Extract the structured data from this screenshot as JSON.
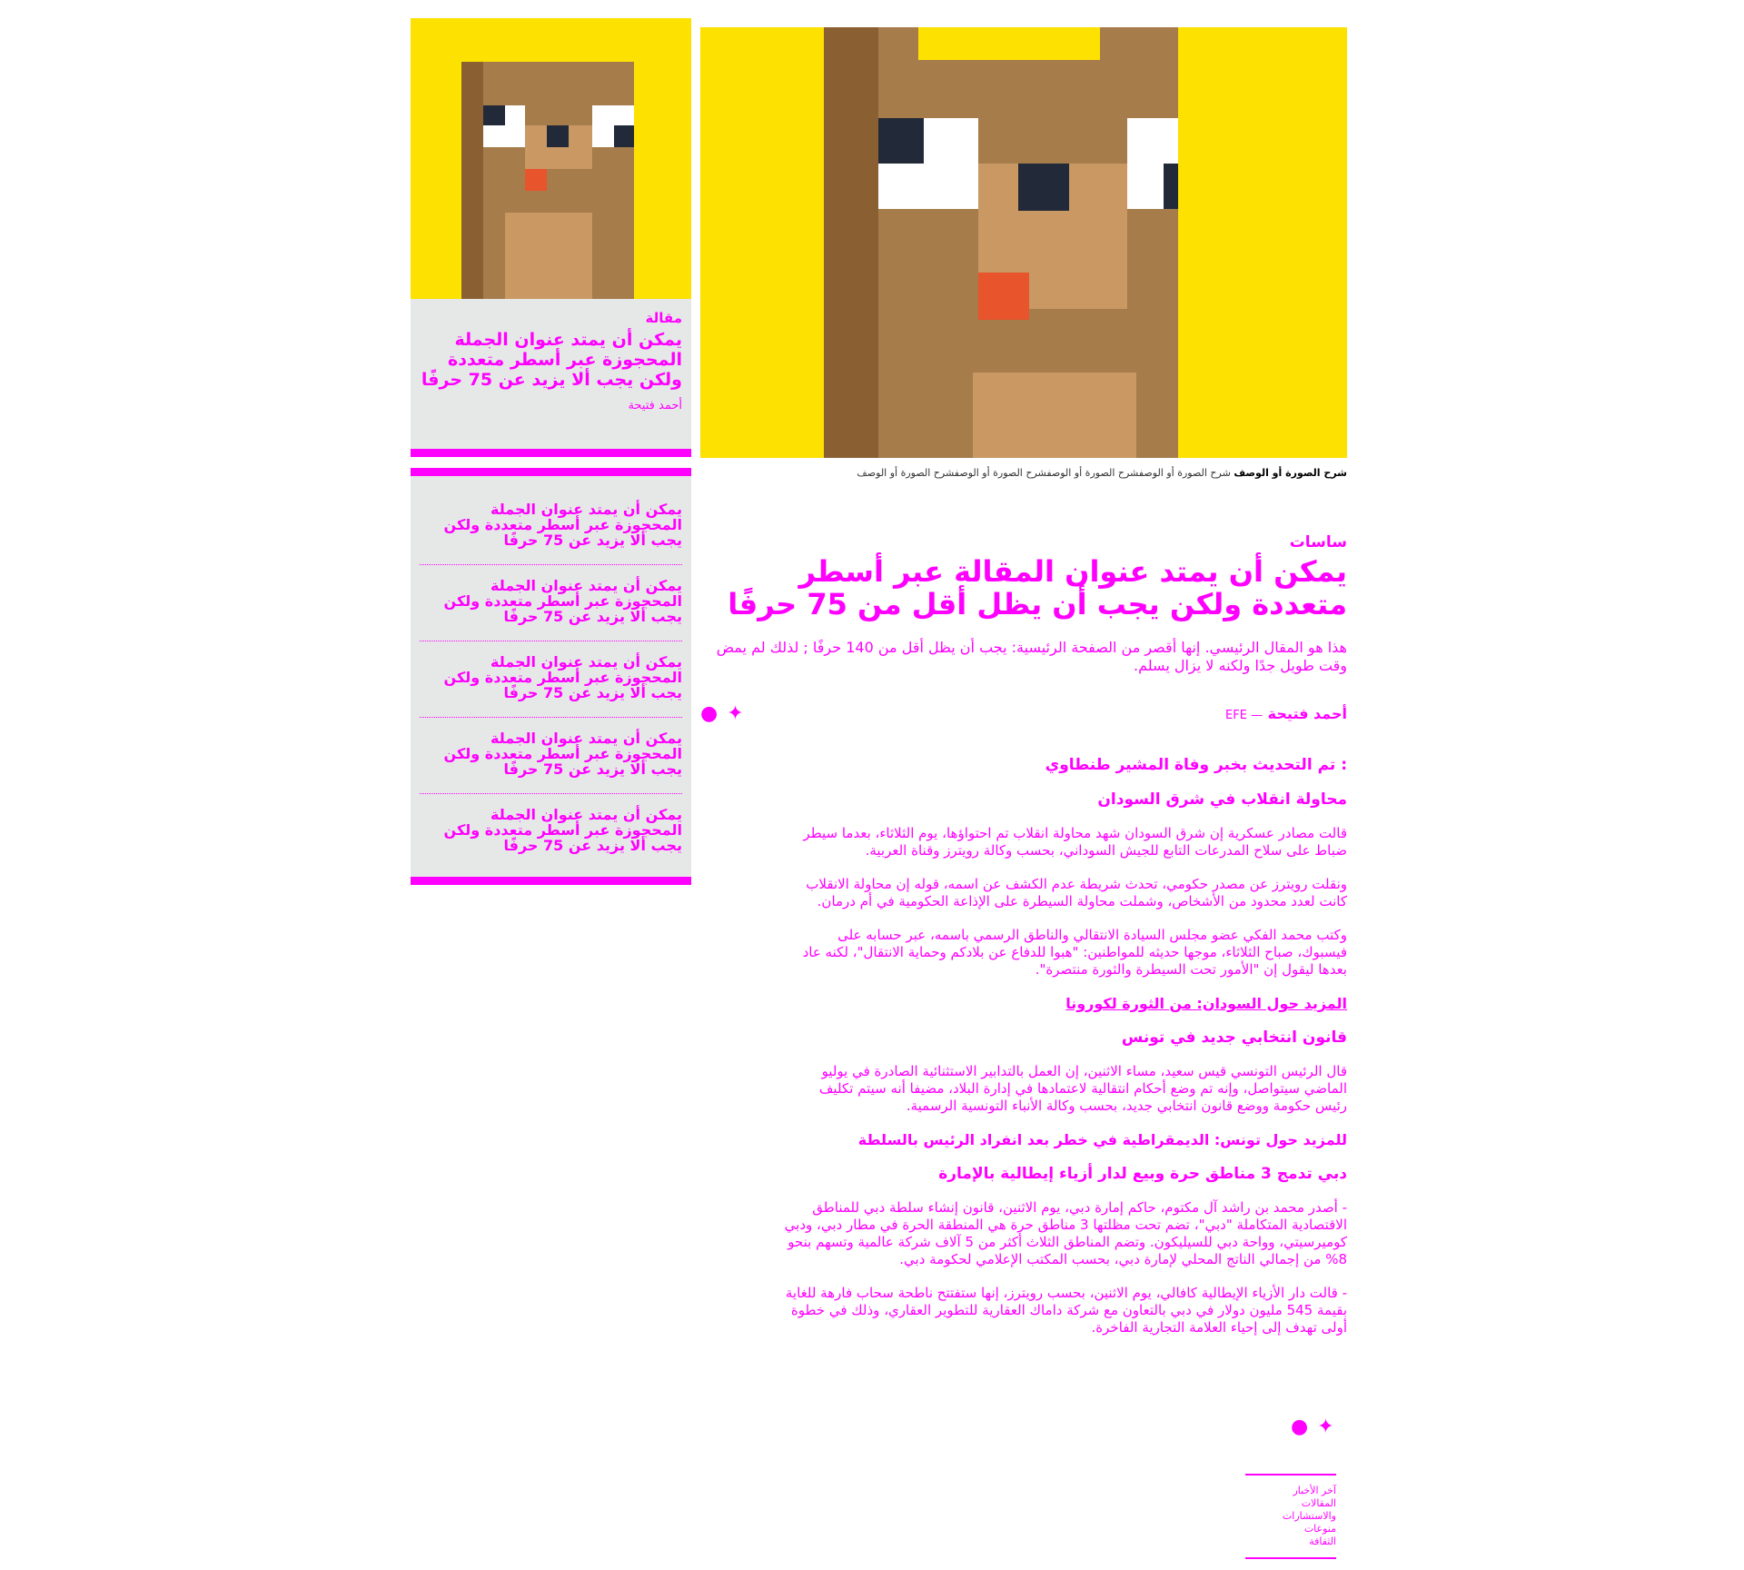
{
  "sidebar": {
    "card": {
      "kicker": "مقالة",
      "title": "يمكن أن يمتد عنوان الجملة المحجوزة عبر أسطر متعددة ولكن يجب ألا يزيد عن 75 حرفًا",
      "author": "أحمد فتيحة"
    },
    "items": [
      "يمكن أن يمتد عنوان الجملة المحجوزة عبر أسطر متعددة ولكن يجب ألا يزيد عن 75 حرفًا",
      "يمكن أن يمتد عنوان الجملة المحجوزة عبر أسطر متعددة ولكن يجب ألا يزيد عن 75 حرفًا",
      "يمكن أن يمتد عنوان الجملة المحجوزة عبر أسطر متعددة ولكن يجب ألا يزيد عن 75 حرفًا",
      "يمكن أن يمتد عنوان الجملة المحجوزة عبر أسطر متعددة ولكن يجب ألا يزيد عن 75 حرفًا",
      "يمكن أن يمتد عنوان الجملة المحجوزة عبر أسطر متعددة ولكن يجب ألا يزيد عن 75 حرفًا"
    ]
  },
  "main": {
    "caption_bold": "شرح الصورة أو الوصف",
    "caption_rest": "شرح الصورة أو الوصفشرح الصورة أو الوصفشرح الصورة أو الوصفشرح الصورة أو الوصف",
    "kicker": "ساسات",
    "title": "يمكن أن يمتد عنوان المقالة عبر أسطر متعددة ولكن يجب أن يظل أقل من 75 حرفًا",
    "lead": "هذا هو المقال الرئيسي. إنها أقصر من الصفحة الرئيسية: يجب أن يظل أقل من 140 حرفًا ; لذلك لم يمض وقت طويل جدًا ولكنه لا يزال يسلم.",
    "author": "أحمد فتيحة",
    "agency": "— EFE",
    "updated": ": تم التحديث بخبر وفاة المشير طنطاوي",
    "sections": [
      {
        "sub": "محاولة انقلاب في شرق السودان",
        "paras": [
          "قالت مصادر عسكرية إن شرق السودان شهد محاولة انقلاب تم احتواؤها، يوم الثلاثاء، بعدما سيطر ضباط على سلاح المدرعات التابع للجيش السوداني، بحسب وكالة رويترز وقناة العربية.",
          "ونقلت رويترز عن مصدر حكومي، تحدث شريطة عدم الكشف عن اسمه، قوله إن محاولة الانقلاب كانت لعدد محدود من الأشخاص، وشملت محاولة السيطرة على الإذاعة الحكومية في أم درمان.",
          "وكتب محمد الفكي عضو مجلس السيادة الانتقالي والناطق الرسمي باسمه، عبر حسابه على فيسبوك، صباح الثلاثاء، موجها حديثه للمواطنين: \"هبوا للدفاع عن بلادكم وحماية الانتقال\"، لكنه عاد بعدها ليقول إن \"الأمور تحت السيطرة والثورة منتصرة\"."
        ],
        "more": "المزيد حول السودان: من الثورة لكورونا"
      },
      {
        "sub": "قانون انتخابي جديد في تونس",
        "paras": [
          "قال الرئيس التونسي قيس سعيد، مساء الاثنين، إن العمل بالتدابير الاستثنائية الصادرة في يوليو الماضي سيتواصل، وإنه تم وضع أحكام انتقالية لاعتمادها في إدارة البلاد، مضيفا أنه سيتم تكليف رئيس حكومة ووضع قانون انتخابي جديد، بحسب وكالة الأنباء التونسية الرسمية."
        ],
        "more": "للمزيد حول تونس: الديمقراطية في خطر بعد انفراد الرئيس بالسلطة"
      },
      {
        "sub": "دبي تدمج 3 مناطق حرة وبيع لدار أزياء إيطالية بالإمارة",
        "paras": [
          "- أصدر محمد بن راشد آل مكتوم، حاكم إمارة دبي، يوم الاثنين، قانون إنشاء سلطة دبي للمناطق الاقتصادية المتكاملة \"دبي\"، تضم تحت مظلتها 3 مناطق حرة هي المنطقة الحرة في مطار دبي، ودبي كوميرسيتي، وواحة دبي للسيليكون. وتضم المناطق الثلاث أكثر من 5 آلاف شركة عالمية وتسهم بنحو 8% من إجمالي الناتج المحلي لإمارة دبي، بحسب المكتب الإعلامي لحكومة دبي.",
          "- قالت دار الأزياء الإيطالية كافالي، يوم الاثنين، بحسب رويترز، إنها ستفتتح ناطحة سحاب فارهة للغاية بقيمة 545 مليون دولار في دبي بالتعاون مع شركة داماك العقارية للتطوير العقاري، وذلك في خطوة أولى تهدف إلى إحياء العلامة التجارية الفاخرة."
        ],
        "more": ""
      }
    ],
    "footer_nav": [
      "آخر الأخبار",
      "المقالات والاستشارات",
      "منوعات",
      "الثقافة"
    ]
  },
  "icons": {
    "twitter": "twitter-icon",
    "whatsapp": "whatsapp-icon"
  },
  "colors": {
    "accent": "#ff00ff",
    "image_bg": "#fde101",
    "panel_bg": "#e6e8e8"
  }
}
